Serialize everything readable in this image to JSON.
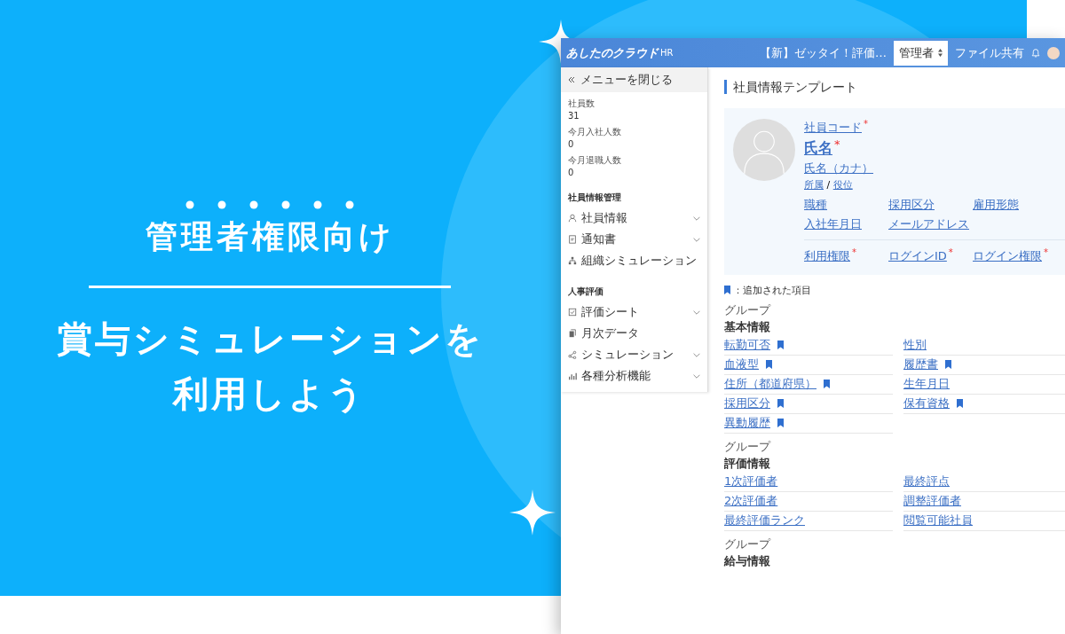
{
  "hero": {
    "lead": "管理者権限向け",
    "title_lines": [
      "賞与シミュレーションを",
      "利用しよう"
    ]
  },
  "app": {
    "logo": "あしたのクラウド",
    "logo_sub": "HR",
    "notice": "【新】ゼッタイ！評価…",
    "role_select": "管理者",
    "file_share": "ファイル共有",
    "sidebar": {
      "close": "メニューを閉じる",
      "stats": [
        {
          "label": "社員数",
          "value": "31"
        },
        {
          "label": "今月入社人数",
          "value": "0"
        },
        {
          "label": "今月退職人数",
          "value": "0"
        }
      ],
      "sections": [
        {
          "title": "社員情報管理",
          "items": [
            {
              "label": "社員情報",
              "expandable": true
            },
            {
              "label": "通知書",
              "expandable": true
            },
            {
              "label": "組織シミュレーション",
              "expandable": false
            }
          ]
        },
        {
          "title": "人事評価",
          "items": [
            {
              "label": "評価シート",
              "expandable": true
            },
            {
              "label": "月次データ",
              "expandable": false
            },
            {
              "label": "シミュレーション",
              "expandable": true
            },
            {
              "label": "各種分析機能",
              "expandable": true
            }
          ]
        }
      ]
    },
    "page_title": "社員情報テンプレート",
    "profile": {
      "code": {
        "label": "社員コード",
        "mark": "*"
      },
      "name": {
        "label": "氏名",
        "mark": "*"
      },
      "kana": "氏名（カナ）",
      "dept": "所属",
      "sep": "/",
      "position": "役位",
      "fields": [
        {
          "label": "職種"
        },
        {
          "label": "採用区分"
        },
        {
          "label": "雇用形態"
        },
        {
          "label": "入社年月日"
        },
        {
          "label": "メールアドレス"
        }
      ],
      "login_fields": [
        {
          "label": "利用権限",
          "mark": "*"
        },
        {
          "label": "ログインID",
          "mark": "*"
        },
        {
          "label": "ログイン権限",
          "mark": "*"
        }
      ]
    },
    "legend": "：追加された項目",
    "groups": [
      {
        "caption": "グループ",
        "title": "基本情報",
        "items": [
          {
            "label": "転勤可否",
            "added": true
          },
          {
            "label": "性別",
            "added": false
          },
          {
            "label": "血液型",
            "added": true
          },
          {
            "label": "履歴書",
            "added": true
          },
          {
            "label": "住所（都道府県）",
            "added": true
          },
          {
            "label": "生年月日",
            "added": false
          },
          {
            "label": "採用区分",
            "added": true
          },
          {
            "label": "保有資格",
            "added": true
          },
          {
            "label": "異動履歴",
            "added": true
          }
        ]
      },
      {
        "caption": "グループ",
        "title": "評価情報",
        "items": [
          {
            "label": "1次評価者",
            "added": false
          },
          {
            "label": "最終評点",
            "added": false
          },
          {
            "label": "2次評価者",
            "added": false
          },
          {
            "label": "調整評価者",
            "added": false
          },
          {
            "label": "最終評価ランク",
            "added": false
          },
          {
            "label": "閲覧可能社員",
            "added": false
          }
        ]
      },
      {
        "caption": "グループ",
        "title": "給与情報"
      }
    ]
  }
}
